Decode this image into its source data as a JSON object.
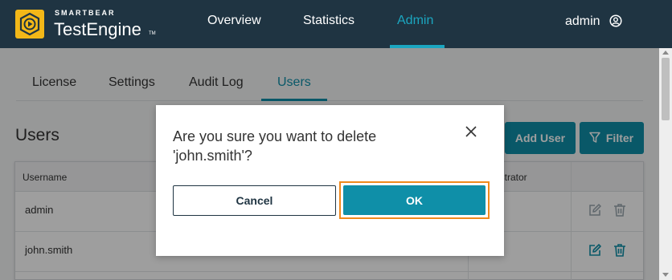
{
  "header": {
    "brand_small": "SMARTBEAR",
    "brand_name": "TestEngine",
    "brand_tm": "TM",
    "nav": [
      "Overview",
      "Statistics",
      "Admin"
    ],
    "user": "admin"
  },
  "tabs": [
    "License",
    "Settings",
    "Audit Log",
    "Users"
  ],
  "page": {
    "title": "Users",
    "add_user_label": "Add User",
    "filter_label": "Filter"
  },
  "table": {
    "columns": [
      "Username",
      "istrator"
    ],
    "rows": [
      "admin",
      "john.smith"
    ]
  },
  "dialog": {
    "message": "Are you sure you want to delete 'john.smith'?",
    "cancel_label": "Cancel",
    "ok_label": "OK"
  },
  "colors": {
    "header_bg": "#1f3442",
    "accent": "#0f8fa8",
    "logo": "#f3b818",
    "focus": "#f08a1c"
  }
}
